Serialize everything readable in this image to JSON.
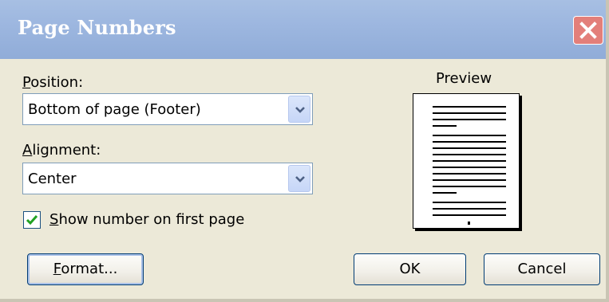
{
  "dialog": {
    "title": "Page Numbers"
  },
  "position": {
    "label_mnemonic": "P",
    "label_rest": "osition:",
    "value": "Bottom of page (Footer)"
  },
  "alignment": {
    "label_mnemonic": "A",
    "label_rest": "lignment:",
    "value": "Center"
  },
  "show_first_page": {
    "checked": true,
    "label_mnemonic": "S",
    "label_rest": "how number on first page"
  },
  "preview": {
    "label": "Preview"
  },
  "buttons": {
    "format_mnemonic": "F",
    "format_rest": "ormat...",
    "ok": "OK",
    "cancel": "Cancel"
  },
  "colors": {
    "titlebar": "#9cb6df",
    "dialog_background": "#ece9d8",
    "close_button": "#e37f7a",
    "checkmark": "#21a121"
  },
  "icons": {
    "close": "close-icon",
    "dropdown": "chevron-down-icon",
    "check": "check-icon"
  }
}
